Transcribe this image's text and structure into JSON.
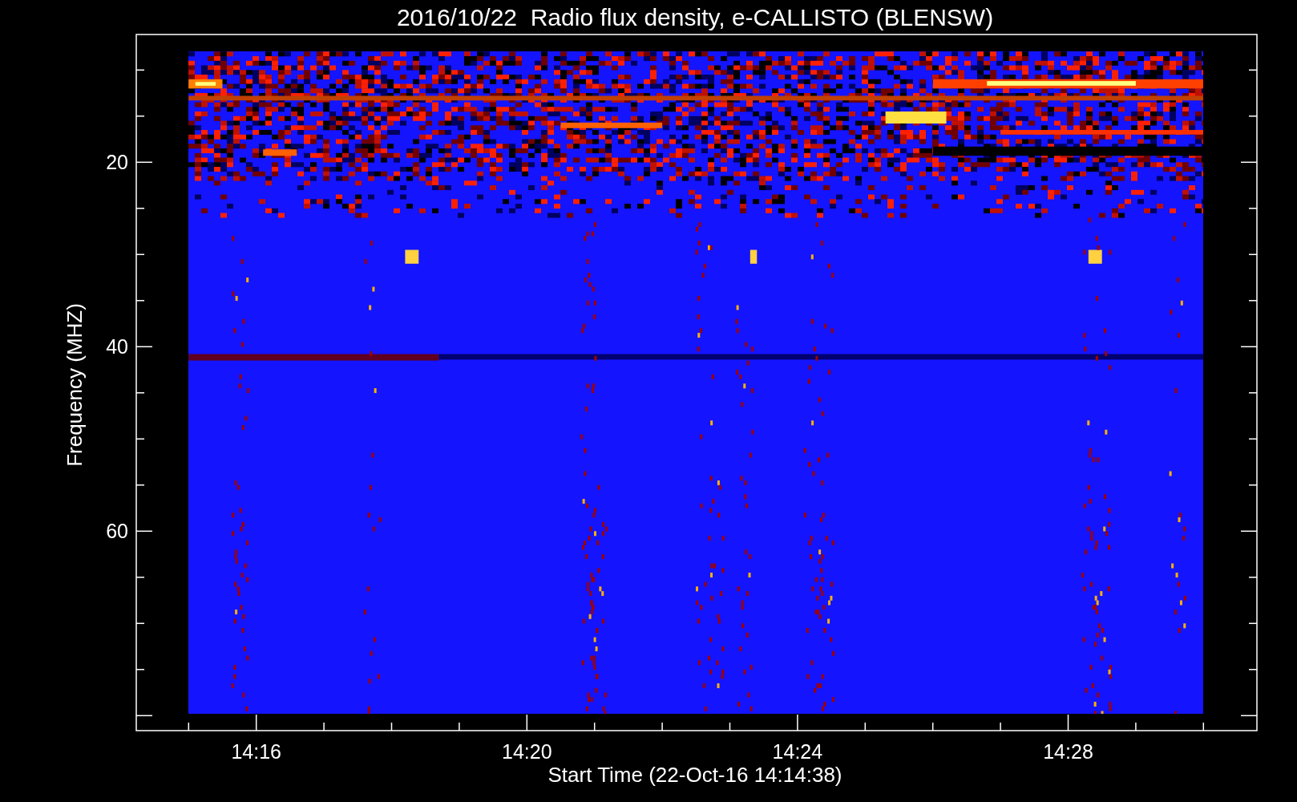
{
  "title": "2016/10/22  Radio flux density, e-CALLISTO (BLENSW)",
  "y_axis": {
    "label": "Frequency (MHZ)",
    "tick_labels": [
      "20",
      "40",
      "60"
    ]
  },
  "x_axis": {
    "label": "Start Time (22-Oct-16 14:14:38)",
    "tick_labels": [
      "14:16",
      "14:20",
      "14:24",
      "14:28"
    ]
  }
}
